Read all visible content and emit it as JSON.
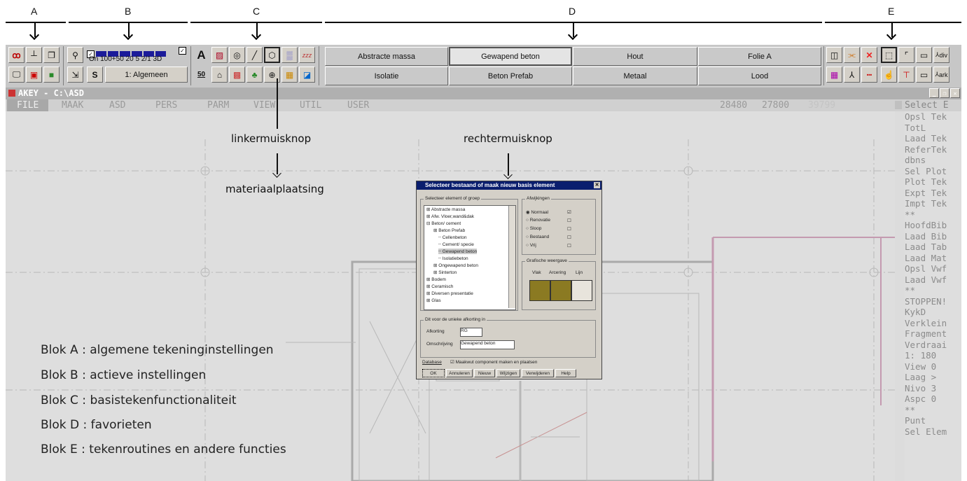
{
  "blocks": {
    "a": "A",
    "b": "B",
    "c": "C",
    "d": "D",
    "e": "E"
  },
  "toolbar": {
    "b_labels": {
      "on": "On",
      "sizes": "100+50  20  5  2/1 3D",
      "s": "S",
      "layer": "1: Algemeen"
    },
    "c_labels": {
      "a": "A",
      "fifty": "50",
      "zzz": "zzz"
    },
    "e_labels": {
      "div": "div",
      "ark": "ark"
    },
    "favorites_row1": [
      "Abstracte massa",
      "Gewapend beton",
      "Hout",
      "Folie A"
    ],
    "favorites_row2": [
      "Isolatie",
      "Beton Prefab",
      "Metaal",
      "Lood"
    ],
    "active_favorite": "Gewapend beton"
  },
  "cad": {
    "title": "AKEY - C:\\ASD",
    "menu": [
      "FILE",
      "MAAK",
      "ASD",
      "PERS",
      "PARM",
      "VIEW",
      "UTIL",
      "USER"
    ],
    "coords": [
      "28480",
      "27800",
      "39799"
    ],
    "select_label": "Select E",
    "right_menu": [
      "Opsl Tek",
      "TotL",
      "Laad Tek",
      "ReferTek",
      "dbns",
      "Sel Plot",
      "Plot Tek",
      "Expt Tek",
      "Impt Tek",
      "**",
      "HoofdBib",
      "Laad Bib",
      "Laad Tab",
      "Laad Mat",
      "Opsl Vwf",
      "Laad Vwf",
      "**",
      "STOPPEN!",
      "KykD",
      "Verklein",
      "Fragment",
      "Verdraai",
      "1:   180",
      "View   0",
      "Laag   >",
      "Nivo   3",
      "Aspc   0",
      "**",
      "Punt",
      "Sel Elem"
    ]
  },
  "annotations": {
    "left_mouse": "linkermuisknop",
    "right_mouse": "rechtermuisknop",
    "placement": "materiaalplaatsing"
  },
  "legend": [
    "Blok A  : algemene tekeninginstellingen",
    "Blok B  : actieve instellingen",
    "Blok C  : basistekenfunctionaliteit",
    "Blok D  : favorieten",
    "Blok E  : tekenroutines en andere functies"
  ],
  "dialog": {
    "title": "Selecteer bestaand of maak nieuw basis element",
    "group_tree": "Selecteer element of groep",
    "tree": [
      "Abstracte massa",
      "Afw. Vloer,wand&dak",
      "Beton/ cement",
      "Beton Prefab",
      "Cellenbeton",
      "Cement/ specie",
      "Gewapend beton",
      "Isolatiebeton",
      "Ongewapend beton",
      "Sinterton",
      "Bodem",
      "Ceramisch",
      "Diversen presentatie",
      "Glas"
    ],
    "selected_item": "Gewapend beton",
    "group_deviations": "Afwijkingen",
    "deviations": [
      "Normaal",
      "Renovatie",
      "Sloop",
      "Bestaand",
      "Vrij"
    ],
    "group_graphic": "Grafische weergave",
    "graphic_cols": [
      "Vlak",
      "Arcering",
      "Lijn"
    ],
    "group_abbrev": "Dit voor de unieke afkorting in",
    "abbrev_label": "Afkorting",
    "abbrev_value": "RG",
    "desc_label": "Omschrijving",
    "desc_value": "Gewapend beton",
    "database_label": "Database",
    "component_label": "Maakwut component maken en plaatsen",
    "buttons": [
      "OK",
      "Annuleren",
      "Nieuw",
      "Wijzigen",
      "Verwijderen",
      "Help"
    ]
  },
  "colors": {
    "swatch": "#8b7a22",
    "dialog_title_bg": "#0a1e6e",
    "active_blue": "#1b1b9a"
  }
}
